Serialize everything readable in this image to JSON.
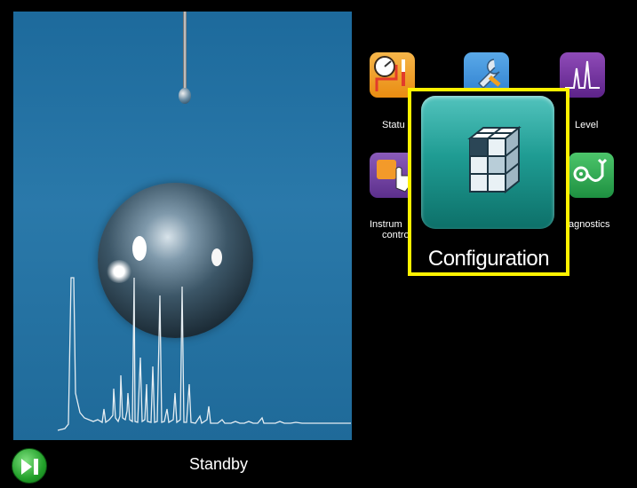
{
  "status_bar": {
    "status_text": "Standby"
  },
  "menu_tiles": [
    {
      "label": "Statu",
      "icon": "status-gauge-icon"
    },
    {
      "label": "",
      "icon": "tools-wrench-icon"
    },
    {
      "label": "Level",
      "icon": "level-peak-icon"
    },
    {
      "label_line1": "Instrum",
      "label_line2": "contro",
      "icon": "instrument-control-hand-icon"
    },
    {
      "label": "agnostics",
      "icon": "diagnostics-stethoscope-icon"
    }
  ],
  "selected_tile": {
    "label": "Configuration",
    "icon": "configuration-cube-icon",
    "highlight_color": "#fff200"
  },
  "colors": {
    "background": "#000000",
    "photo_blue": "#1f6a99",
    "config_teal": "#1f9c93",
    "play_green": "#22a02a"
  }
}
